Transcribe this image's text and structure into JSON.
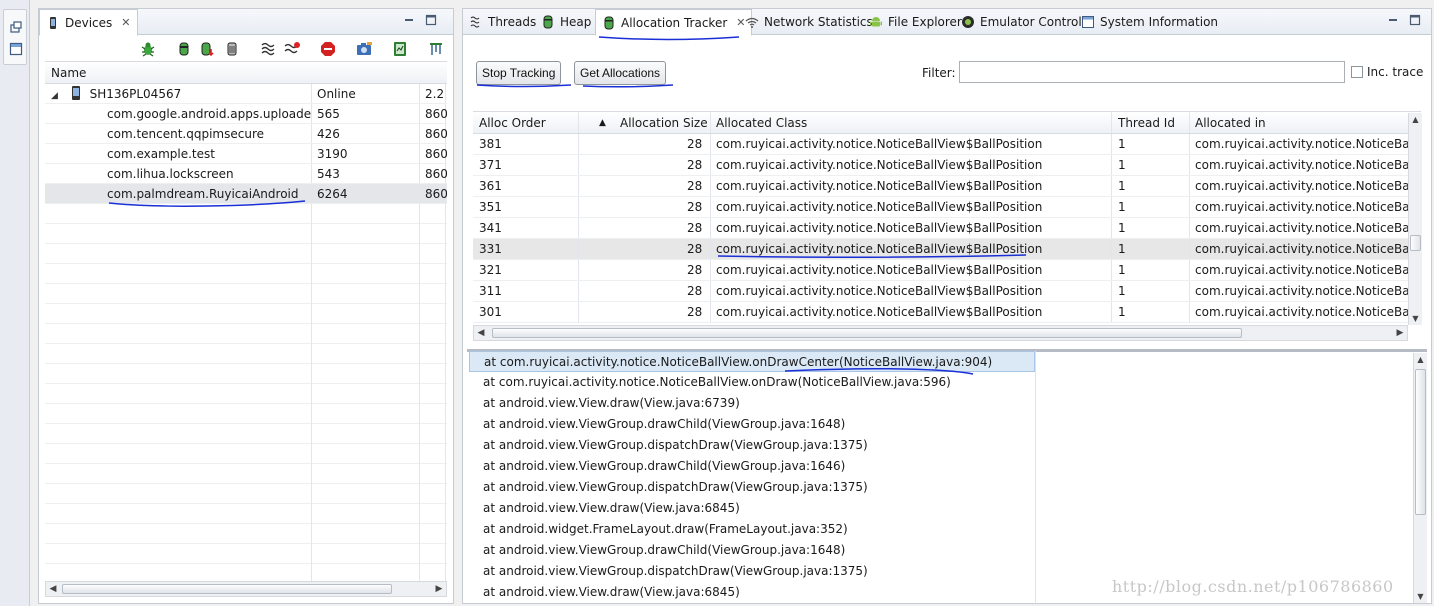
{
  "devices_view": {
    "tab_label": "Devices",
    "column_name": "Name",
    "device": {
      "serial": "SH136PL04567",
      "status": "Online",
      "version": "2.2"
    },
    "processes": [
      {
        "name": "com.google.android.apps.uploade",
        "pid": "565",
        "port": "860"
      },
      {
        "name": "com.tencent.qqpimsecure",
        "pid": "426",
        "port": "860"
      },
      {
        "name": "com.example.test",
        "pid": "3190",
        "port": "860"
      },
      {
        "name": "com.lihua.lockscreen",
        "pid": "543",
        "port": "860"
      },
      {
        "name": "com.palmdream.RuyicaiAndroid",
        "pid": "6264",
        "port": "860"
      }
    ],
    "toolbar_icons": [
      "debug-bug-icon",
      "update-heap-icon",
      "dump-hprof-icon",
      "cause-gc-icon",
      "update-threads-icon",
      "start-method-profiling-icon",
      "stop-process-icon",
      "screen-capture-icon",
      "systrace-icon",
      "hierarchy-dump-icon",
      "view-menu-icon"
    ]
  },
  "tabs": [
    {
      "label": "Threads",
      "icon": "threads-icon"
    },
    {
      "label": "Heap",
      "icon": "heap-cylinder-icon"
    },
    {
      "label": "Allocation Tracker",
      "icon": "allocation-cylinder-icon"
    },
    {
      "label": "Network Statistics",
      "icon": "wifi-icon"
    },
    {
      "label": "File Explorer",
      "icon": "android-icon"
    },
    {
      "label": "Emulator Control",
      "icon": "phone-control-icon"
    },
    {
      "label": "System Information",
      "icon": "window-icon"
    }
  ],
  "allocation_tracker": {
    "stop_tracking_label": "Stop Tracking",
    "get_allocations_label": "Get Allocations",
    "filter_label": "Filter:",
    "filter_value": "",
    "inc_trace_label": "Inc. trace",
    "columns": [
      "Alloc Order",
      "Allocation Size",
      "Allocated Class",
      "Thread Id",
      "Allocated in"
    ],
    "sort_indicator": "▲",
    "rows": [
      {
        "order": "381",
        "size": "28",
        "cls": "com.ruyicai.activity.notice.NoticeBallView$BallPosition",
        "thread": "1",
        "alloc_in": "com.ruyicai.activity.notice.NoticeBallV"
      },
      {
        "order": "371",
        "size": "28",
        "cls": "com.ruyicai.activity.notice.NoticeBallView$BallPosition",
        "thread": "1",
        "alloc_in": "com.ruyicai.activity.notice.NoticeBallV"
      },
      {
        "order": "361",
        "size": "28",
        "cls": "com.ruyicai.activity.notice.NoticeBallView$BallPosition",
        "thread": "1",
        "alloc_in": "com.ruyicai.activity.notice.NoticeBallV"
      },
      {
        "order": "351",
        "size": "28",
        "cls": "com.ruyicai.activity.notice.NoticeBallView$BallPosition",
        "thread": "1",
        "alloc_in": "com.ruyicai.activity.notice.NoticeBallV"
      },
      {
        "order": "341",
        "size": "28",
        "cls": "com.ruyicai.activity.notice.NoticeBallView$BallPosition",
        "thread": "1",
        "alloc_in": "com.ruyicai.activity.notice.NoticeBallV"
      },
      {
        "order": "331",
        "size": "28",
        "cls": "com.ruyicai.activity.notice.NoticeBallView$BallPosition",
        "thread": "1",
        "alloc_in": "com.ruyicai.activity.notice.NoticeBallV"
      },
      {
        "order": "321",
        "size": "28",
        "cls": "com.ruyicai.activity.notice.NoticeBallView$BallPosition",
        "thread": "1",
        "alloc_in": "com.ruyicai.activity.notice.NoticeBallV"
      },
      {
        "order": "311",
        "size": "28",
        "cls": "com.ruyicai.activity.notice.NoticeBallView$BallPosition",
        "thread": "1",
        "alloc_in": "com.ruyicai.activity.notice.NoticeBallV"
      },
      {
        "order": "301",
        "size": "28",
        "cls": "com.ruyicai.activity.notice.NoticeBallView$BallPosition",
        "thread": "1",
        "alloc_in": "com.ruyicai.activity.notice.NoticeBallV"
      }
    ],
    "stack_trace": [
      "at com.ruyicai.activity.notice.NoticeBallView.onDrawCenter(NoticeBallView.java:904)",
      "at com.ruyicai.activity.notice.NoticeBallView.onDraw(NoticeBallView.java:596)",
      "at android.view.View.draw(View.java:6739)",
      "at android.view.ViewGroup.drawChild(ViewGroup.java:1648)",
      "at android.view.ViewGroup.dispatchDraw(ViewGroup.java:1375)",
      "at android.view.ViewGroup.drawChild(ViewGroup.java:1646)",
      "at android.view.ViewGroup.dispatchDraw(ViewGroup.java:1375)",
      "at android.view.View.draw(View.java:6845)",
      "at android.widget.FrameLayout.draw(FrameLayout.java:352)",
      "at android.view.ViewGroup.drawChild(ViewGroup.java:1648)",
      "at android.view.ViewGroup.dispatchDraw(ViewGroup.java:1375)",
      "at android.view.View.draw(View.java:6845)"
    ]
  },
  "watermark": "http://blog.csdn.net/p106786860",
  "colors": {
    "ink": "#1a2fd6",
    "selection": "#dbe8f6",
    "panel_border": "#c7ccd4"
  }
}
